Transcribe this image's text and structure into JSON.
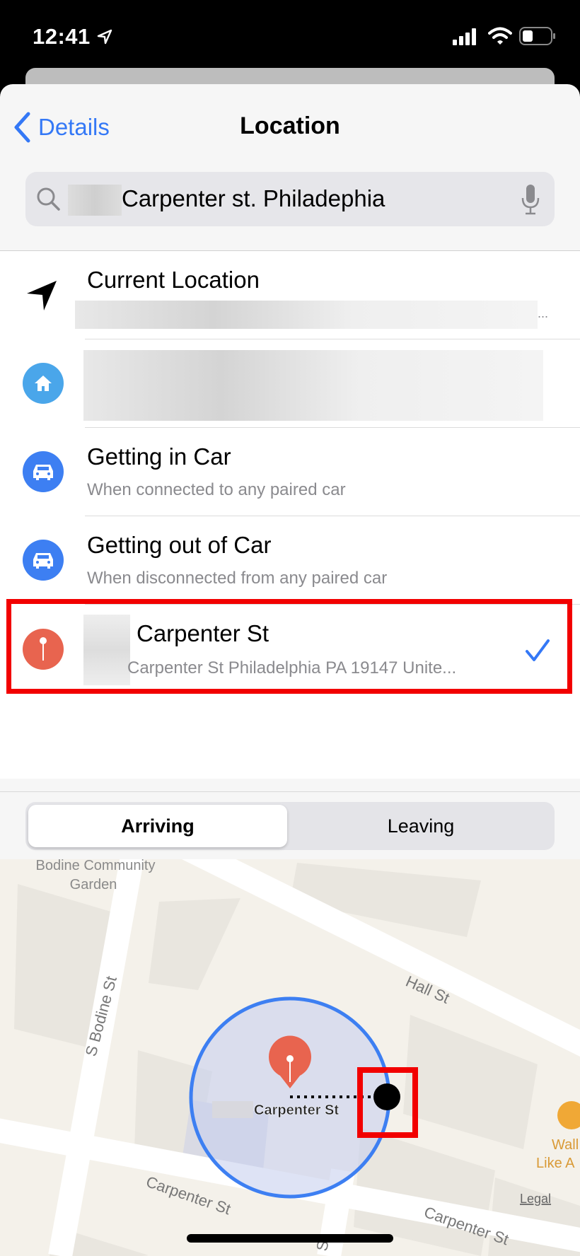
{
  "status_bar": {
    "time": "12:41",
    "icons": [
      "location-arrow-icon",
      "cellular-signal-icon",
      "wifi-icon",
      "battery-icon"
    ]
  },
  "nav": {
    "back_label": "Details",
    "title": "Location"
  },
  "search": {
    "value": "Carpenter st. Philadephia",
    "icons": [
      "search-icon",
      "microphone-icon"
    ]
  },
  "list": {
    "items": [
      {
        "title": "Current Location",
        "subtitle": "",
        "more": "...",
        "icon": "location-arrow-icon"
      },
      {
        "title": "",
        "subtitle": "",
        "icon": "home-icon",
        "icon_color": "#4aa6ea"
      },
      {
        "title": "Getting in Car",
        "subtitle": "When connected to any paired car",
        "icon": "car-icon",
        "icon_color": "#3d7ff2"
      },
      {
        "title": "Getting out of Car",
        "subtitle": "When disconnected from any paired car",
        "icon": "car-icon",
        "icon_color": "#3d7ff2"
      },
      {
        "title": "Carpenter St",
        "subtitle": "Carpenter St Philadelphia PA 19147 Unite...",
        "icon": "pin-icon",
        "icon_color": "#e8644f",
        "selected": true
      }
    ]
  },
  "segment": {
    "options": [
      "Arriving",
      "Leaving"
    ],
    "selected": "Arriving"
  },
  "map": {
    "pin_label": "Carpenter St",
    "labels": {
      "garden_line1": "Bodine Community",
      "garden_line2": "Garden",
      "bodine": "S Bodine St",
      "hall": "Hall St",
      "carpenter1": "Carpenter St",
      "carpenter2": "Carpenter St",
      "poi_line1": "Wall",
      "poi_line2": "Like A",
      "cross_street": "St"
    },
    "legal": "Legal",
    "geofence_color": "#3d7ff2"
  },
  "colors": {
    "accent": "#3478f6",
    "highlight": "#f20000",
    "pin": "#e8644f"
  }
}
